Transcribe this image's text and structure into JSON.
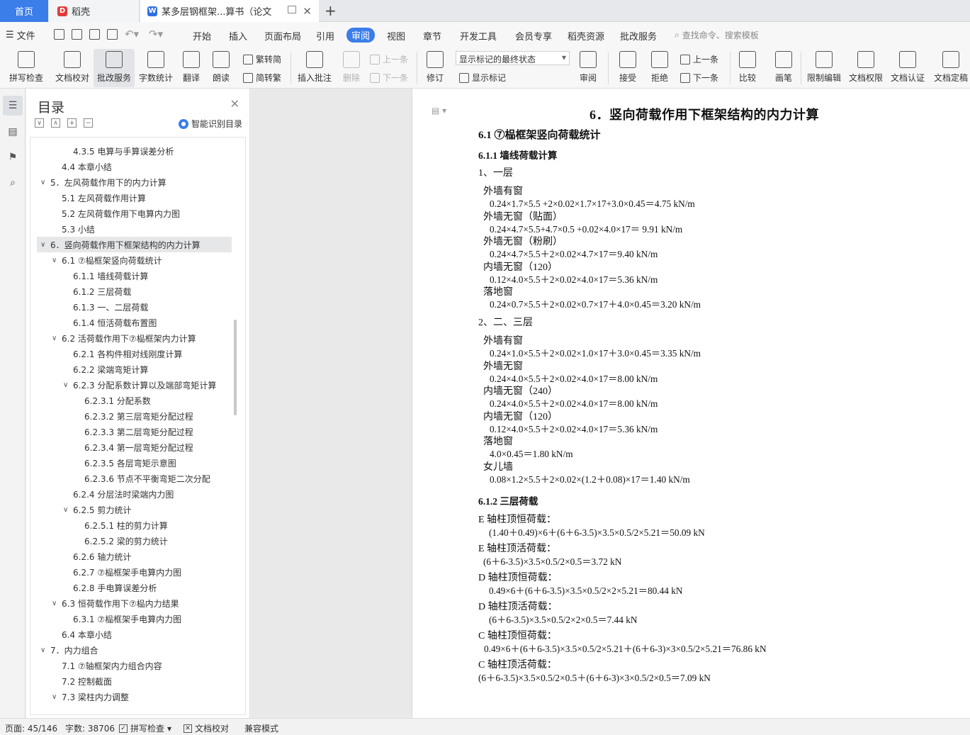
{
  "tabs": {
    "home": "首页",
    "daoke": "稻壳",
    "doc": "某多层钢框架...算书（论文）"
  },
  "menu": {
    "file": "文件",
    "items": [
      "开始",
      "插入",
      "页面布局",
      "引用",
      "审阅",
      "视图",
      "章节",
      "开发工具",
      "会员专享",
      "稻壳资源",
      "批改服务"
    ],
    "search": "查找命令、搜索模板"
  },
  "ribbon": {
    "spell": "拼写检查",
    "proof": "文档校对",
    "correct": "批改服务",
    "count": "字数统计",
    "translate": "翻译",
    "read": "朗读",
    "to_trad": "繁转简",
    "to_simp": "简转繁",
    "insert_comment": "插入批注",
    "delete": "删除",
    "prev": "上一条",
    "next": "下一条",
    "revise": "修订",
    "markup_state": "显示标记的最终状态",
    "show_markup": "显示标记",
    "review": "审阅",
    "accept": "接受",
    "reject": "拒绝",
    "prev2": "上一条",
    "next2": "下一条",
    "compare": "比较",
    "pen": "画笔",
    "restrict": "限制编辑",
    "rights": "文档权限",
    "certify": "文档认证",
    "finalize": "文档定稿"
  },
  "toc": {
    "title": "目录",
    "smart": "智能识别目录",
    "items": [
      "4.3.5 电算与手算误差分析",
      "4.4 本章小结",
      "5．左风荷载作用下的内力计算",
      "5.1  左风荷载作用计算",
      "5.2  左风荷载作用下电算内力图",
      "5.3  小结",
      "6．竖向荷载作用下框架结构的内力计算",
      "6.1  ⑦榀框架竖向荷载统计",
      "6.1.1    墙线荷载计算",
      "6.1.2    三层荷载",
      "6.1.3    一、二层荷载",
      "6.1.4    恒活荷载布置图",
      "6.2 活荷载作用下⑦榀框架内力计算",
      "6.2.1 各构件相对线刚度计算",
      "6.2.2 梁端弯矩计算",
      "6.2.3 分配系数计算以及端部弯矩计算",
      "6.2.3.1  分配系数",
      "6.2.3.2  第三层弯矩分配过程",
      "6.2.3.3  第二层弯矩分配过程",
      "6.2.3.4  第一层弯矩分配过程",
      "6.2.3.5  各层弯矩示意图",
      "6.2.3.6 节点不平衡弯矩二次分配",
      "6.2.4 分层法时梁端内力图",
      "6.2.5 剪力统计",
      "6.2.5.1 柱的剪力计算",
      "6.2.5.2 梁的剪力统计",
      "6.2.6 轴力统计",
      "6.2.7  ⑦榀框架手电算内力图",
      "6.2.8 手电算误差分析",
      "6.3 恒荷载作用下⑦榀内力结果",
      "6.3.1  ⑦榀框架手电算内力图",
      "6.4 本章小结",
      "7．内力组合",
      "7.1  ⑦轴框架内力组合内容",
      "7.2  控制截面",
      "7.3 梁柱内力调整"
    ]
  },
  "doc": {
    "h1": "6．竖向荷载作用下框架结构的内力计算",
    "h2": "6.1  ⑦榀框架竖向荷载统计",
    "h3a": "6.1.1    墙线荷载计算",
    "floor1": "1、一层",
    "f1": [
      [
        "外墙有窗",
        "0.24×1.7×5.5  +2×0.02×1.7×17+3.0×0.45＝4.75 kN/m"
      ],
      [
        "外墙无窗（贴面）",
        "0.24×4.7×5.5+4.7×0.5  +0.02×4.0×17＝  9.91 kN/m"
      ],
      [
        "外墙无窗（粉刷）",
        "0.24×4.7×5.5＋2×0.02×4.7×17＝9.40 kN/m"
      ],
      [
        "内墙无窗（120）",
        "0.12×4.0×5.5＋2×0.02×4.0×17＝5.36 kN/m"
      ],
      [
        "落地窗",
        "0.24×0.7×5.5＋2×0.02×0.7×17＋4.0×0.45＝3.20 kN/m"
      ]
    ],
    "floor2": "2、二、三层",
    "f2": [
      [
        "外墙有窗",
        "0.24×1.0×5.5＋2×0.02×1.0×17＋3.0×0.45＝3.35 kN/m"
      ],
      [
        "外墙无窗",
        "0.24×4.0×5.5＋2×0.02×4.0×17＝8.00 kN/m"
      ],
      [
        "内墙无窗（240）",
        "0.24×4.0×5.5＋2×0.02×4.0×17＝8.00 kN/m"
      ],
      [
        "内墙无窗（120）",
        "0.12×4.0×5.5＋2×0.02×4.0×17＝5.36 kN/m"
      ],
      [
        "落地窗",
        "4.0×0.45＝1.80 kN/m"
      ],
      [
        "女儿墙",
        "0.08×1.2×5.5＋2×0.02×(1.2＋0.08)×17＝1.40 kN/m"
      ]
    ],
    "h3b": "6.1.2    三层荷载",
    "loads": [
      [
        "E 轴柱顶恒荷载：",
        "(1.40＋0.49)×6＋(6＋6-3.5)×3.5×0.5/2×5.21＝50.09 kN"
      ],
      [
        "E 轴柱顶活荷载：",
        "(6＋6-3.5)×3.5×0.5/2×0.5＝3.72 kN"
      ],
      [
        "D 轴柱顶恒荷载：",
        "0.49×6＋(6＋6-3.5)×3.5×0.5/2×2×5.21＝80.44 kN"
      ],
      [
        "D 轴柱顶活荷载：",
        "(6＋6-3.5)×3.5×0.5/2×2×0.5＝7.44 kN"
      ],
      [
        "C 轴柱顶恒荷载：",
        "0.49×6＋(6＋6-3.5)×3.5×0.5/2×5.21＋(6＋6-3)×3×0.5/2×5.21＝76.86 kN"
      ],
      [
        "C 轴柱顶活荷载：",
        "(6＋6-3.5)×3.5×0.5/2×0.5＋(6＋6-3)×3×0.5/2×0.5＝7.09 kN"
      ]
    ]
  },
  "status": {
    "page": "页面: 45/146",
    "words": "字数: 38706",
    "spell": "拼写检查",
    "proof": "文档校对",
    "compat": "兼容模式"
  }
}
